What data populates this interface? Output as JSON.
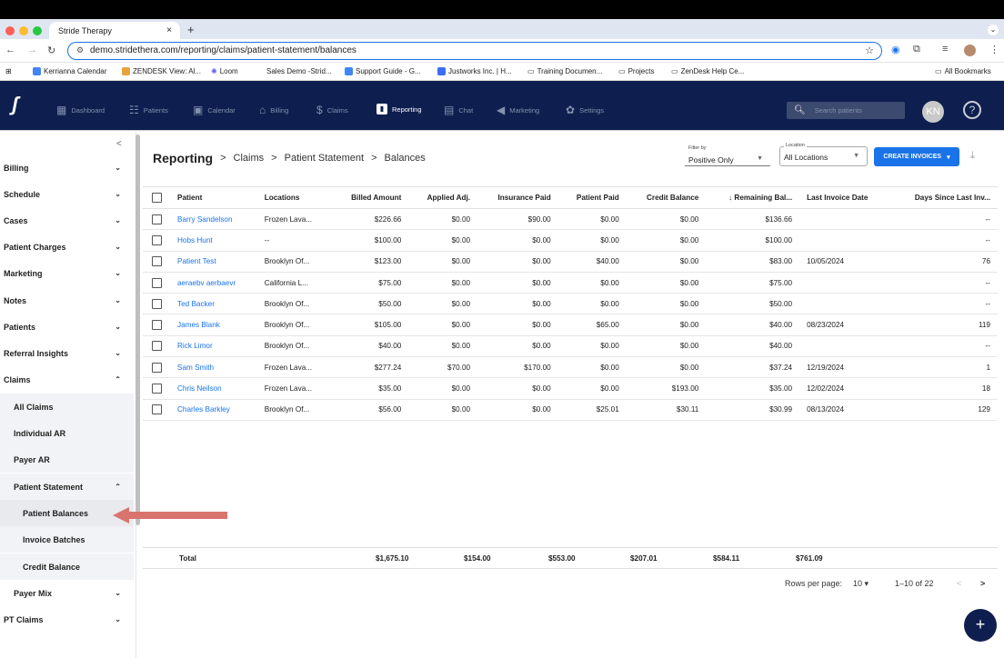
{
  "browser": {
    "tab_title": "Stride Therapy",
    "url": "demo.stridethera.com/reporting/claims/patient-statement/balances",
    "bookmarks": [
      "Kerrianna Calendar",
      "ZENDESK View: Al...",
      "Loom",
      "Sales Demo -Strid...",
      "Support Guide - G...",
      "Justworks Inc. | H...",
      "Training Documen...",
      "Projects",
      "ZenDesk Help Ce...",
      "All Bookmarks"
    ]
  },
  "appnav": {
    "items": [
      "Dashboard",
      "Patients",
      "Calendar",
      "Billing",
      "Claims",
      "Reporting",
      "Chat",
      "Marketing",
      "Settings"
    ],
    "active": "Reporting",
    "search_placeholder": "Search patients",
    "avatar": "KN",
    "help": "?"
  },
  "sidebar": {
    "collapse": "<",
    "items": [
      {
        "label": "Billing",
        "caret": "⌄"
      },
      {
        "label": "Schedule",
        "caret": "⌄"
      },
      {
        "label": "Cases",
        "caret": "⌄"
      },
      {
        "label": "Patient Charges",
        "caret": "⌄"
      },
      {
        "label": "Marketing",
        "caret": "⌄"
      },
      {
        "label": "Notes",
        "caret": "⌄"
      },
      {
        "label": "Patients",
        "caret": "⌄"
      },
      {
        "label": "Referral Insights",
        "caret": "⌄"
      },
      {
        "label": "Claims",
        "caret": "⌃"
      },
      {
        "label": "All Claims",
        "caret": ""
      },
      {
        "label": "Individual AR",
        "caret": ""
      },
      {
        "label": "Payer AR",
        "caret": ""
      },
      {
        "label": "Patient Statement",
        "caret": "⌃"
      },
      {
        "label": "Patient Balances",
        "caret": ""
      },
      {
        "label": "Invoice Batches",
        "caret": ""
      },
      {
        "label": "Credit Balance",
        "caret": ""
      },
      {
        "label": "Payer Mix",
        "caret": "⌄"
      },
      {
        "label": "PT Claims",
        "caret": "⌄"
      }
    ]
  },
  "breadcrumb": {
    "root": "Reporting",
    "sep": ">",
    "items": [
      "Claims",
      "Patient Statement",
      "Balances"
    ]
  },
  "filters": {
    "filter_label": "Filter by",
    "filter_value": "Positive Only",
    "location_label": "Location",
    "location_value": "All Locations",
    "create_label": "CREATE INVOICES"
  },
  "table": {
    "headers": [
      "Patient",
      "Locations",
      "Billed Amount",
      "Applied Adj.",
      "Insurance Paid",
      "Patient Paid",
      "Credit Balance",
      "Remaining Bal...",
      "Last Invoice Date",
      "Days Since Last Inv..."
    ],
    "rows": [
      [
        "Barry Sandelson",
        "Frozen Lava...",
        "$226.66",
        "$0.00",
        "$90.00",
        "$0.00",
        "$0.00",
        "$136.66",
        "",
        "--"
      ],
      [
        "Hobs Hunt",
        "--",
        "$100.00",
        "$0.00",
        "$0.00",
        "$0.00",
        "$0.00",
        "$100.00",
        "",
        "--"
      ],
      [
        "Patient Test",
        "Brooklyn Of...",
        "$123.00",
        "$0.00",
        "$0.00",
        "$40.00",
        "$0.00",
        "$83.00",
        "10/05/2024",
        "76"
      ],
      [
        "aeraebv aerbaevr",
        "California L...",
        "$75.00",
        "$0.00",
        "$0.00",
        "$0.00",
        "$0.00",
        "$75.00",
        "",
        "--"
      ],
      [
        "Ted Backer",
        "Brooklyn Of...",
        "$50.00",
        "$0.00",
        "$0.00",
        "$0.00",
        "$0.00",
        "$50.00",
        "",
        "--"
      ],
      [
        "James Blank",
        "Brooklyn Of...",
        "$105.00",
        "$0.00",
        "$0.00",
        "$65.00",
        "$0.00",
        "$40.00",
        "08/23/2024",
        "119"
      ],
      [
        "Rick Limor",
        "Brooklyn Of...",
        "$40.00",
        "$0.00",
        "$0.00",
        "$0.00",
        "$0.00",
        "$40.00",
        "",
        "--"
      ],
      [
        "Sam Smith",
        "Frozen Lava...",
        "$277.24",
        "$70.00",
        "$170.00",
        "$0.00",
        "$0.00",
        "$37.24",
        "12/19/2024",
        "1"
      ],
      [
        "Chris Neilson",
        "Frozen Lava...",
        "$35.00",
        "$0.00",
        "$0.00",
        "$0.00",
        "$193.00",
        "$35.00",
        "12/02/2024",
        "18"
      ],
      [
        "Charles Barkley",
        "Brooklyn Of...",
        "$56.00",
        "$0.00",
        "$0.00",
        "$25.01",
        "$30.11",
        "$30.99",
        "08/13/2024",
        "129"
      ]
    ]
  },
  "totals": {
    "label": "Total",
    "billed": "$1,675.10",
    "adj": "$154.00",
    "ins": "$553.00",
    "pat": "$207.01",
    "credit": "$584.11",
    "remaining": "$761.09"
  },
  "pagination": {
    "rows_label": "Rows per page:",
    "rows_value": "10",
    "range": "1–10 of 22"
  },
  "colors": {
    "navbar": "#0e1f4f",
    "accent": "#1a73e8",
    "arrow": "#d9736d"
  }
}
